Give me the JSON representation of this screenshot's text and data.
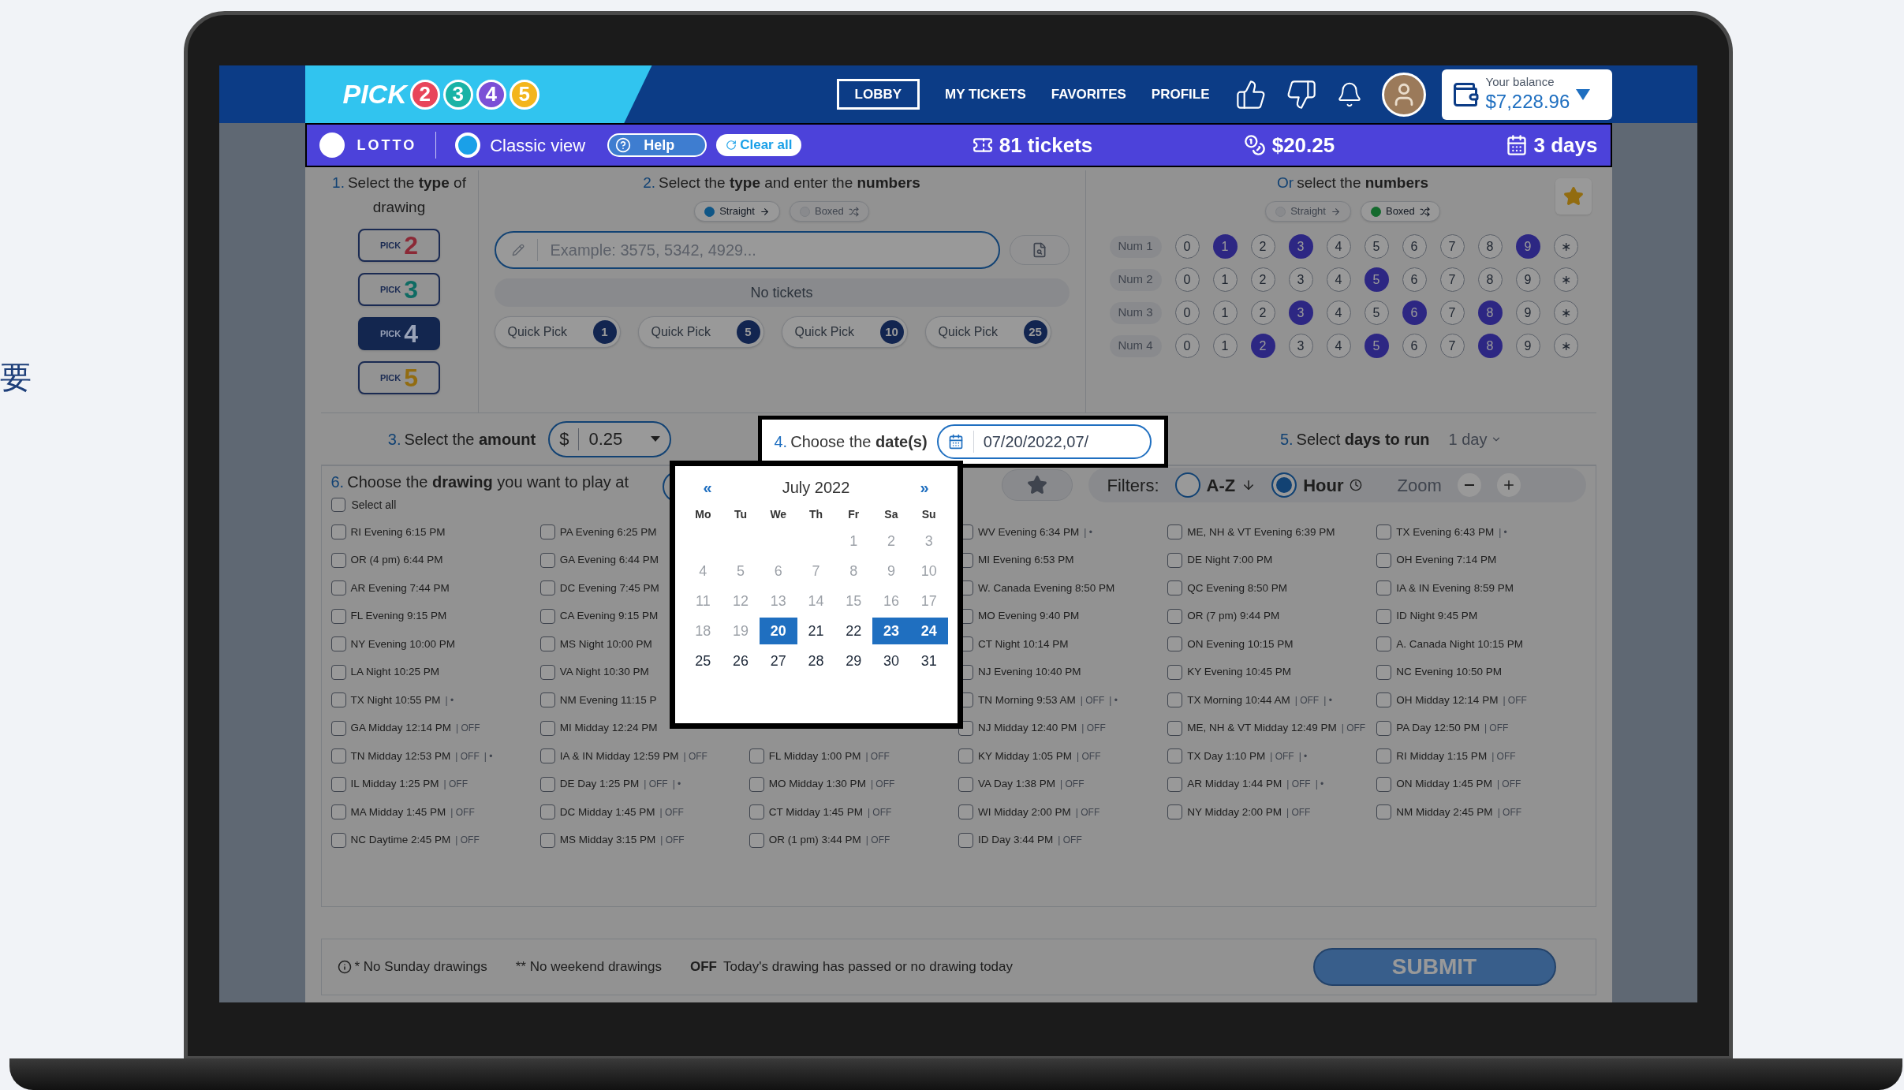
{
  "side_text": "要",
  "header": {
    "logo": {
      "word": "PICK",
      "digits": [
        {
          "text": "2",
          "color": "#e8455a"
        },
        {
          "text": "3",
          "color": "#19b3a6"
        },
        {
          "text": "4",
          "color": "#7b4fd6"
        },
        {
          "text": "5",
          "color": "#f3b51c"
        }
      ]
    },
    "nav": [
      {
        "label": "LOBBY",
        "selected": true
      },
      {
        "label": "MY TICKETS",
        "selected": false
      },
      {
        "label": "FAVORITES",
        "selected": false
      },
      {
        "label": "PROFILE",
        "selected": false
      }
    ],
    "balance": {
      "label": "Your balance",
      "amount": "$7,228.96"
    }
  },
  "toolbar": {
    "brand": "LOTTO",
    "view": {
      "label": "Classic view",
      "selected": true
    },
    "help": "Help",
    "clear": "Clear all",
    "tickets": "81 tickets",
    "cost": "$20.25",
    "days": "3 days"
  },
  "type_section": {
    "num": "1.",
    "title": "Select the **type** of drawing",
    "picks": [
      {
        "word": "PICK",
        "number": "2",
        "color": "#8b2936",
        "selected": false
      },
      {
        "word": "PICK",
        "number": "3",
        "color": "#0f6b63",
        "selected": false
      },
      {
        "word": "PICK",
        "number": "4",
        "color": "#9aa3b8",
        "selected": true
      },
      {
        "word": "PICK",
        "number": "5",
        "color": "#926c11",
        "selected": false
      }
    ]
  },
  "entry_section": {
    "num": "2.",
    "title": "Select the **type** and enter the **numbers**",
    "modes": [
      {
        "kind": "straight",
        "label": "Straight",
        "selected": true
      },
      {
        "kind": "boxed",
        "label": "Boxed",
        "selected": false
      }
    ],
    "placeholder": "Example: 3575, 5342, 4929...",
    "empty": "No tickets",
    "quick_picks": [
      {
        "label": "Quick Pick",
        "count": "1"
      },
      {
        "label": "Quick Pick",
        "count": "5"
      },
      {
        "label": "Quick Pick",
        "count": "10"
      },
      {
        "label": "Quick Pick",
        "count": "25"
      }
    ]
  },
  "numbers_section": {
    "lead": "Or",
    "title": "select the **numbers**",
    "modes": [
      {
        "kind": "straight",
        "label": "Straight",
        "selected": false
      },
      {
        "kind": "boxed",
        "label": "Boxed",
        "selected": true
      }
    ],
    "rows": [
      {
        "label": "Num 1",
        "cells": [
          {
            "text": "0",
            "selected": false
          },
          {
            "text": "1",
            "selected": true
          },
          {
            "text": "2",
            "selected": false
          },
          {
            "text": "3",
            "selected": true
          },
          {
            "text": "4",
            "selected": false
          },
          {
            "text": "5",
            "selected": false
          },
          {
            "text": "6",
            "selected": false
          },
          {
            "text": "7",
            "selected": false
          },
          {
            "text": "8",
            "selected": false
          },
          {
            "text": "9",
            "selected": true
          },
          {
            "text": "∗",
            "selected": false
          }
        ]
      },
      {
        "label": "Num 2",
        "cells": [
          {
            "text": "0",
            "selected": false
          },
          {
            "text": "1",
            "selected": false
          },
          {
            "text": "2",
            "selected": false
          },
          {
            "text": "3",
            "selected": false
          },
          {
            "text": "4",
            "selected": false
          },
          {
            "text": "5",
            "selected": true
          },
          {
            "text": "6",
            "selected": false
          },
          {
            "text": "7",
            "selected": false
          },
          {
            "text": "8",
            "selected": false
          },
          {
            "text": "9",
            "selected": false
          },
          {
            "text": "∗",
            "selected": false
          }
        ]
      },
      {
        "label": "Num 3",
        "cells": [
          {
            "text": "0",
            "selected": false
          },
          {
            "text": "1",
            "selected": false
          },
          {
            "text": "2",
            "selected": false
          },
          {
            "text": "3",
            "selected": true
          },
          {
            "text": "4",
            "selected": false
          },
          {
            "text": "5",
            "selected": false
          },
          {
            "text": "6",
            "selected": true
          },
          {
            "text": "7",
            "selected": false
          },
          {
            "text": "8",
            "selected": true
          },
          {
            "text": "9",
            "selected": false
          },
          {
            "text": "∗",
            "selected": false
          }
        ]
      },
      {
        "label": "Num 4",
        "cells": [
          {
            "text": "0",
            "selected": false
          },
          {
            "text": "1",
            "selected": false
          },
          {
            "text": "2",
            "selected": true
          },
          {
            "text": "3",
            "selected": false
          },
          {
            "text": "4",
            "selected": false
          },
          {
            "text": "5",
            "selected": true
          },
          {
            "text": "6",
            "selected": false
          },
          {
            "text": "7",
            "selected": false
          },
          {
            "text": "8",
            "selected": true
          },
          {
            "text": "9",
            "selected": false
          },
          {
            "text": "∗",
            "selected": false
          }
        ]
      }
    ]
  },
  "amount": {
    "num": "3.",
    "title": "Select the **amount**",
    "currency": "$",
    "value": "0.25"
  },
  "dates": {
    "num": "4.",
    "title": "Choose the **date(s)**",
    "value": "07/20/2022,07/"
  },
  "days_to_run": {
    "num": "5.",
    "title": "Select **days to run**",
    "value": "1 day"
  },
  "calendar": {
    "month": "July 2022",
    "prev": "«",
    "next": "»",
    "weekdays": [
      "Mo",
      "Tu",
      "We",
      "Th",
      "Fr",
      "Sa",
      "Su"
    ],
    "weeks": [
      [
        {
          "text": "1",
          "muted": true,
          "selected": false
        },
        {
          "text": "2",
          "muted": true,
          "selected": false
        },
        {
          "text": "3",
          "muted": true,
          "selected": false
        }
      ],
      [
        {
          "text": "4",
          "muted": true,
          "selected": false
        },
        {
          "text": "5",
          "muted": true,
          "selected": false
        },
        {
          "text": "6",
          "muted": true,
          "selected": false
        },
        {
          "text": "7",
          "muted": true,
          "selected": false
        },
        {
          "text": "8",
          "muted": true,
          "selected": false
        },
        {
          "text": "9",
          "muted": true,
          "selected": false
        },
        {
          "text": "10",
          "muted": true,
          "selected": false
        }
      ],
      [
        {
          "text": "11",
          "muted": true,
          "selected": false
        },
        {
          "text": "12",
          "muted": true,
          "selected": false
        },
        {
          "text": "13",
          "muted": true,
          "selected": false
        },
        {
          "text": "14",
          "muted": true,
          "selected": false
        },
        {
          "text": "15",
          "muted": true,
          "selected": false
        },
        {
          "text": "16",
          "muted": true,
          "selected": false
        },
        {
          "text": "17",
          "muted": true,
          "selected": false
        }
      ],
      [
        {
          "text": "18",
          "muted": true,
          "selected": false
        },
        {
          "text": "19",
          "muted": true,
          "selected": false
        },
        {
          "text": "20",
          "muted": false,
          "selected": true
        },
        {
          "text": "21",
          "muted": false,
          "selected": false
        },
        {
          "text": "22",
          "muted": false,
          "selected": false
        },
        {
          "text": "23",
          "muted": false,
          "selected": true
        },
        {
          "text": "24",
          "muted": false,
          "selected": true
        }
      ],
      [
        {
          "text": "25",
          "muted": false,
          "selected": false
        },
        {
          "text": "26",
          "muted": false,
          "selected": false
        },
        {
          "text": "27",
          "muted": false,
          "selected": false
        },
        {
          "text": "28",
          "muted": false,
          "selected": false
        },
        {
          "text": "29",
          "muted": false,
          "selected": false
        },
        {
          "text": "30",
          "muted": false,
          "selected": false
        },
        {
          "text": "31",
          "muted": false,
          "selected": false
        }
      ]
    ]
  },
  "drawings": {
    "num": "6.",
    "title": "Choose the **drawing** you want to play at",
    "select_all": {
      "label": "Select all",
      "checked": false
    },
    "filters": {
      "label": "Filters:",
      "options": [
        {
          "label": "A-Z",
          "selected": false
        },
        {
          "label": "Hour",
          "selected": true
        }
      ],
      "zoom": "Zoom"
    },
    "columns": [
      {
        "items": [
          {
            "label": "RI Evening 6:15 PM",
            "checked": false
          },
          {
            "label": "OR (4 pm) 6:44 PM",
            "checked": false
          },
          {
            "label": "AR Evening 7:44 PM",
            "checked": false
          },
          {
            "label": "FL Evening 9:15 PM",
            "checked": false
          },
          {
            "label": "NY Evening 10:00 PM",
            "checked": false
          },
          {
            "label": "LA Night 10:25 PM",
            "checked": false
          },
          {
            "label": "TX Night 10:55 PM",
            "checked": false,
            "tags": [
              "| •"
            ]
          },
          {
            "label": "GA Midday 12:14 PM",
            "checked": false,
            "tags": [
              "| OFF"
            ]
          },
          {
            "label": "TN Midday 12:53 PM",
            "checked": false,
            "tags": [
              "| OFF",
              "| •"
            ]
          },
          {
            "label": "IL Midday 1:25 PM",
            "checked": false,
            "tags": [
              "| OFF"
            ]
          },
          {
            "label": "MA Midday 1:45 PM",
            "checked": false,
            "tags": [
              "| OFF"
            ]
          },
          {
            "label": "NC Daytime 2:45 PM",
            "checked": false,
            "tags": [
              "| OFF"
            ]
          }
        ]
      },
      {
        "items": [
          {
            "label": "PA Evening 6:25 PM",
            "checked": false
          },
          {
            "label": "GA Evening 6:44 PM",
            "checked": false
          },
          {
            "label": "DC Evening 7:45 PM",
            "checked": false
          },
          {
            "label": "CA Evening 9:15 PM",
            "checked": false
          },
          {
            "label": "MS Night 10:00 PM",
            "checked": false
          },
          {
            "label": "VA Night 10:30 PM",
            "checked": false
          },
          {
            "label": "NM Evening 11:15 P",
            "checked": false
          },
          {
            "label": "MI Midday 12:24 PM",
            "checked": false
          },
          {
            "label": "IA & IN Midday 12:59 PM",
            "checked": false,
            "tags": [
              "| OFF"
            ]
          },
          {
            "label": "DE Day 1:25 PM",
            "checked": false,
            "tags": [
              "| OFF",
              "| •"
            ]
          },
          {
            "label": "DC Midday 1:45 PM",
            "checked": false,
            "tags": [
              "| OFF"
            ]
          },
          {
            "label": "MS Midday 3:15 PM",
            "checked": false,
            "tags": [
              "| OFF"
            ]
          }
        ]
      },
      {
        "covered": true,
        "items": [
          {
            "label": "FL Midday 1:00 PM",
            "checked": false,
            "tags": [
              "| OFF"
            ]
          },
          {
            "label": "MO Midday 1:30 PM",
            "checked": false,
            "tags": [
              "| OFF"
            ]
          },
          {
            "label": "CT Midday 1:45 PM",
            "checked": false,
            "tags": [
              "| OFF"
            ]
          },
          {
            "label": "OR (1 pm) 3:44 PM",
            "checked": false,
            "tags": [
              "| OFF"
            ]
          }
        ]
      },
      {
        "items": [
          {
            "label": "WV Evening 6:34 PM",
            "checked": false,
            "tags": [
              "| •"
            ]
          },
          {
            "label": "MI Evening 6:53 PM",
            "checked": false
          },
          {
            "label": "W. Canada Evening 8:50 PM",
            "checked": false
          },
          {
            "label": "MO Evening 9:40 PM",
            "checked": false
          },
          {
            "label": "CT Night 10:14 PM",
            "checked": false
          },
          {
            "label": "NJ Evening 10:40 PM",
            "checked": false
          },
          {
            "label": "TN Morning 9:53 AM",
            "checked": false,
            "tags": [
              "| OFF",
              "| •"
            ]
          },
          {
            "label": "NJ Midday 12:40 PM",
            "checked": false,
            "tags": [
              "| OFF"
            ]
          },
          {
            "label": "KY Midday 1:05 PM",
            "checked": false,
            "tags": [
              "| OFF"
            ]
          },
          {
            "label": "VA Day 1:38 PM",
            "checked": false,
            "tags": [
              "| OFF"
            ]
          },
          {
            "label": "WI Midday 2:00 PM",
            "checked": false,
            "tags": [
              "| OFF"
            ]
          },
          {
            "label": "ID Day 3:44 PM",
            "checked": false,
            "tags": [
              "| OFF"
            ]
          }
        ]
      },
      {
        "items": [
          {
            "label": "ME, NH & VT Evening 6:39 PM",
            "checked": false
          },
          {
            "label": "DE Night 7:00 PM",
            "checked": false
          },
          {
            "label": "QC Evening 8:50 PM",
            "checked": false
          },
          {
            "label": "OR (7 pm) 9:44 PM",
            "checked": false
          },
          {
            "label": "ON Evening 10:15 PM",
            "checked": false
          },
          {
            "label": "KY Evening 10:45 PM",
            "checked": false
          },
          {
            "label": "TX Morning 10:44 AM",
            "checked": false,
            "tags": [
              "| OFF",
              "| •"
            ]
          },
          {
            "label": "ME, NH & VT Midday 12:49 PM",
            "checked": false,
            "tags": [
              "| OFF"
            ]
          },
          {
            "label": "TX Day 1:10 PM",
            "checked": false,
            "tags": [
              "| OFF",
              "| •"
            ]
          },
          {
            "label": "AR Midday 1:44 PM",
            "checked": false,
            "tags": [
              "| OFF",
              "| •"
            ]
          },
          {
            "label": "NY Midday 2:00 PM",
            "checked": false,
            "tags": [
              "| OFF"
            ]
          }
        ]
      },
      {
        "items": [
          {
            "label": "TX Evening 6:43 PM",
            "checked": false,
            "tags": [
              "| •"
            ]
          },
          {
            "label": "OH Evening 7:14 PM",
            "checked": false
          },
          {
            "label": "IA & IN Evening 8:59 PM",
            "checked": false
          },
          {
            "label": "ID Night 9:45 PM",
            "checked": false
          },
          {
            "label": "A. Canada Night 10:15 PM",
            "checked": false
          },
          {
            "label": "NC Evening 10:50 PM",
            "checked": false
          },
          {
            "label": "OH Midday 12:14 PM",
            "checked": false,
            "tags": [
              "| OFF"
            ]
          },
          {
            "label": "PA Day 12:50 PM",
            "checked": false,
            "tags": [
              "| OFF"
            ]
          },
          {
            "label": "RI Midday 1:15 PM",
            "checked": false,
            "tags": [
              "| OFF"
            ]
          },
          {
            "label": "ON Midday 1:45 PM",
            "checked": false,
            "tags": [
              "| OFF"
            ]
          },
          {
            "label": "NM Midday 2:45 PM",
            "checked": false,
            "tags": [
              "| OFF"
            ]
          }
        ]
      }
    ]
  },
  "footer": {
    "notes": [
      {
        "kind": "info",
        "text": "* No Sunday drawings"
      },
      {
        "kind": "plain",
        "text": "** No weekend drawings"
      },
      {
        "kind": "key",
        "key": "OFF",
        "text": "Today's drawing has passed or no drawing today"
      }
    ],
    "submit": "SUBMIT"
  }
}
